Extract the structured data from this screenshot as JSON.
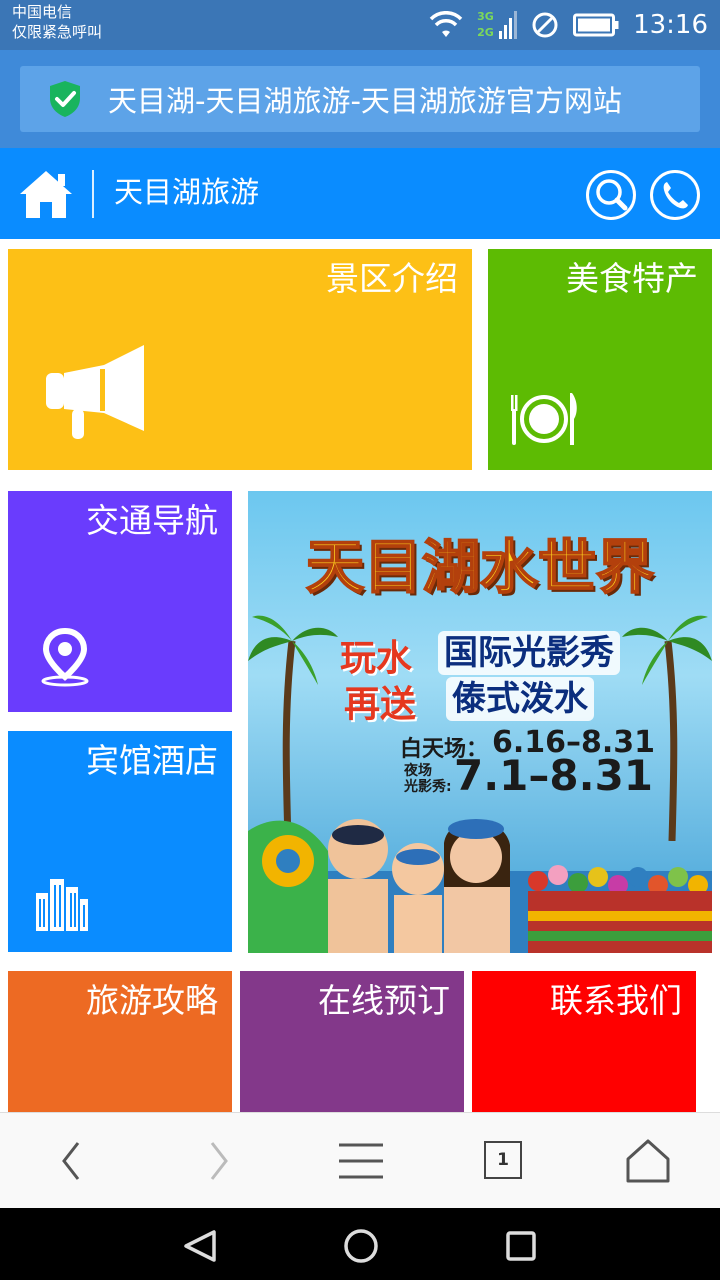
{
  "status_bar": {
    "carrier_line1": "中国电信",
    "carrier_line2": "仅限紧急呼叫",
    "network_label_top": "3G",
    "network_label_bottom": "2G",
    "time": "13:16",
    "icons": [
      "wifi-icon",
      "signal-icon",
      "no-sim-icon",
      "battery-icon"
    ]
  },
  "browser": {
    "page_title": "天目湖-天目湖旅游-天目湖旅游官方网站",
    "secure_icon": "shield-check-icon",
    "tab_count": "1"
  },
  "header": {
    "title": "天目湖旅游",
    "icons": [
      "home-icon",
      "search-icon",
      "phone-icon"
    ]
  },
  "tiles": {
    "scenic": {
      "label": "景区介绍",
      "icon": "megaphone-icon",
      "color": "#fdc016"
    },
    "food": {
      "label": "美食特产",
      "icon": "plate-icon",
      "color": "#5dbb03"
    },
    "traffic": {
      "label": "交通导航",
      "icon": "location-pin-icon",
      "color": "#6a3cfd"
    },
    "hotel": {
      "label": "宾馆酒店",
      "icon": "buildings-icon",
      "color": "#0a8cff"
    },
    "guide": {
      "label": "旅游攻略",
      "color": "#ed6a23"
    },
    "booking": {
      "label": "在线预订",
      "color": "#83388a"
    },
    "contact": {
      "label": "联系我们",
      "color": "#ff0000"
    }
  },
  "banner": {
    "title": "天目湖水世界",
    "tag_line1": "玩水",
    "tag_line2": "再送",
    "show_line1": "国际光影秀",
    "show_line2": "傣式泼水",
    "day_label": "白天场：",
    "day_dates": "6.16–8.31",
    "night_label_line1": "夜场",
    "night_label_line2": "光影秀:",
    "night_dates": "7.1–8.31"
  },
  "bottom_bar": {
    "icons": [
      "back-arrow-icon",
      "forward-arrow-icon",
      "menu-icon",
      "tabs-icon",
      "home-icon"
    ]
  },
  "system_nav": {
    "icons": [
      "back-triangle-icon",
      "home-circle-icon",
      "recent-square-icon"
    ]
  }
}
